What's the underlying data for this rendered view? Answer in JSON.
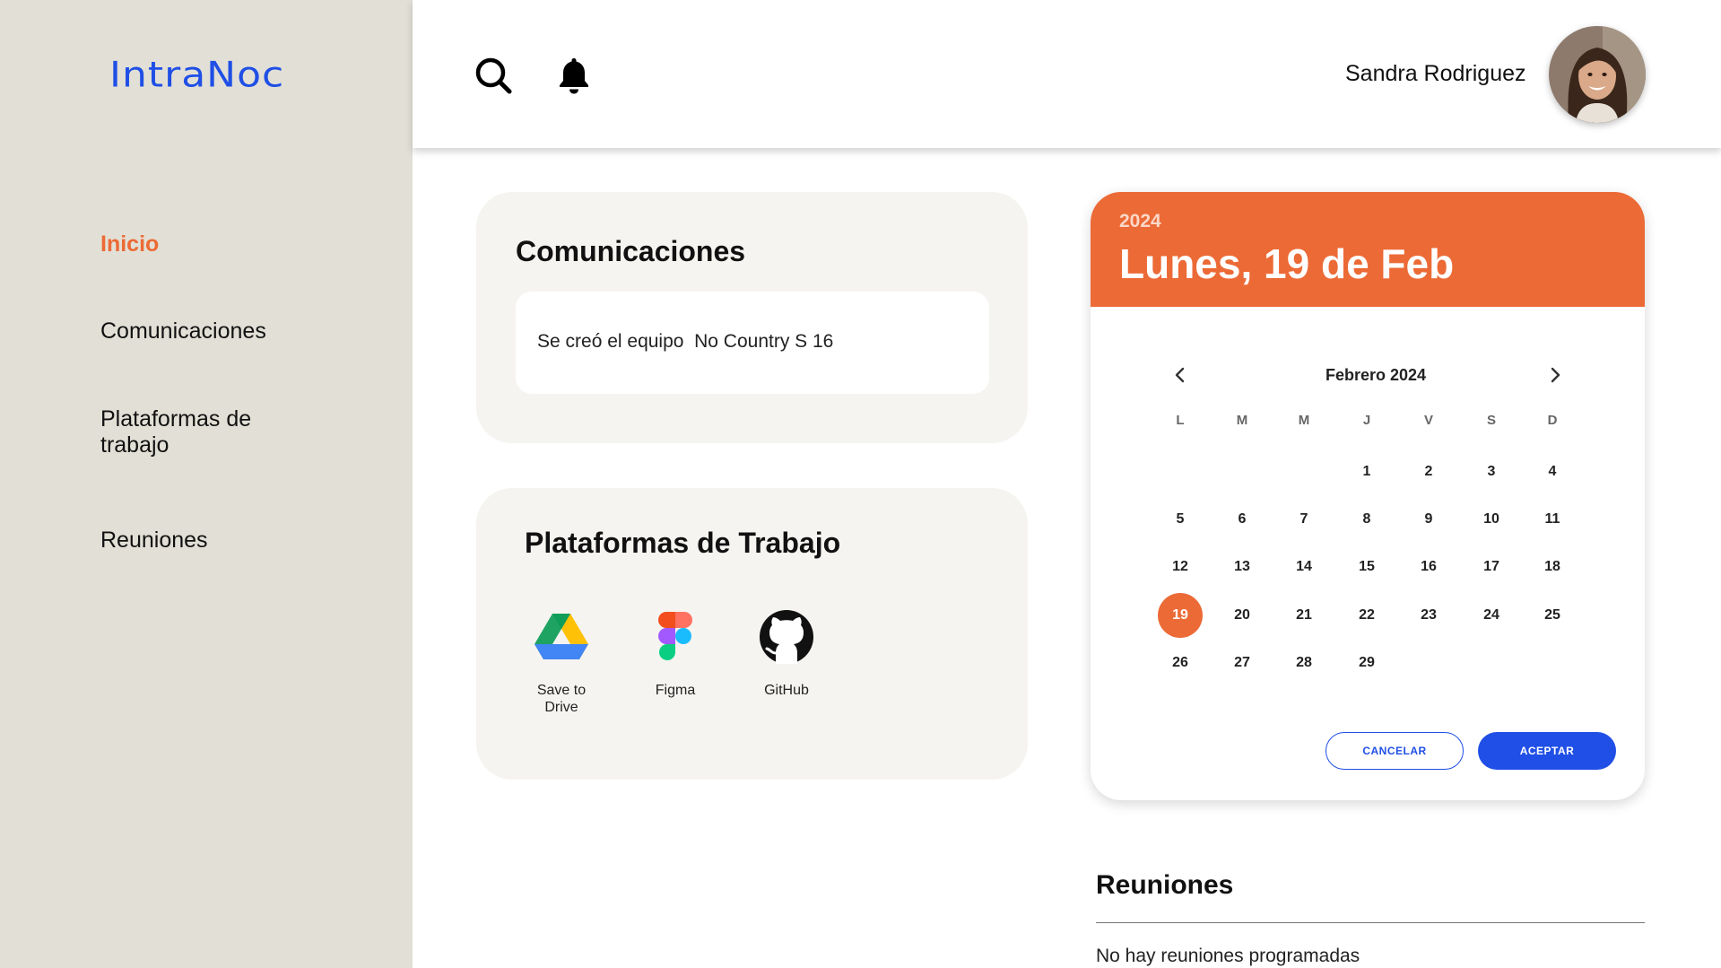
{
  "app": {
    "logo": "IntraNoc",
    "brand_color": "#1f4fe6",
    "accent_color": "#ec6a36"
  },
  "sidebar": {
    "items": [
      {
        "label": "Inicio",
        "active": true
      },
      {
        "label": "Comunicaciones",
        "active": false
      },
      {
        "label": "Plataformas de trabajo",
        "active": false
      },
      {
        "label": "Reuniones",
        "active": false
      }
    ]
  },
  "header": {
    "icons": [
      "search-icon",
      "bell-icon"
    ],
    "user_name": "Sandra Rodriguez"
  },
  "communications": {
    "title": "Comunicaciones",
    "items": [
      {
        "text": "Se creó el equipo  No Country S 16"
      }
    ]
  },
  "platforms": {
    "title": "Plataformas de Trabajo",
    "items": [
      {
        "label": "Save to\nDrive",
        "icon": "google-drive-icon"
      },
      {
        "label": "Figma",
        "icon": "figma-icon"
      },
      {
        "label": "GitHub",
        "icon": "github-icon"
      }
    ]
  },
  "calendar": {
    "year": "2024",
    "selected_label": "Lunes, 19 de Feb",
    "month_label": "Febrero 2024",
    "weekdays": [
      "L",
      "M",
      "M",
      "J",
      "V",
      "S",
      "D"
    ],
    "first_weekday_index": 3,
    "days_in_month": 29,
    "selected_day": "19",
    "cancel_label": "CANCELAR",
    "accept_label": "ACEPTAR"
  },
  "meetings": {
    "title": "Reuniones",
    "empty_text": "No hay reuniones programadas"
  }
}
